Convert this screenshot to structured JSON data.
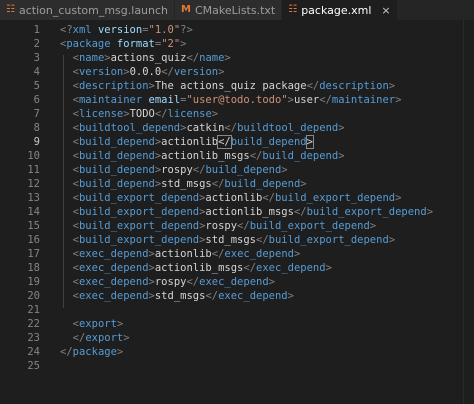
{
  "tabs": [
    {
      "label": "action_custom_msg.launch",
      "icon": "rss-icon",
      "icon_glyph": "☷",
      "icon_color": "#e37933",
      "active": false
    },
    {
      "label": "CMakeLists.txt",
      "icon": "cmake-icon",
      "icon_glyph": "M",
      "icon_color": "#e37933",
      "active": false
    },
    {
      "label": "package.xml",
      "icon": "rss-icon",
      "icon_glyph": "☷",
      "icon_color": "#e37933",
      "active": true,
      "close": "×"
    }
  ],
  "colors": {
    "background": "#1e1e1e",
    "tag": "#569cd6",
    "attribute": "#9cdcfe",
    "string": "#ce9178",
    "punctuation": "#808080",
    "text": "#d4d4d4",
    "line_number": "#858585"
  },
  "current_line": 9,
  "lines": [
    {
      "n": "1",
      "tokens": [
        {
          "t": "punc",
          "v": "<?"
        },
        {
          "t": "tag",
          "v": "xml"
        },
        {
          "t": "text",
          "v": " "
        },
        {
          "t": "attr",
          "v": "version"
        },
        {
          "t": "punc",
          "v": "="
        },
        {
          "t": "str",
          "v": "\"1.0\""
        },
        {
          "t": "punc",
          "v": "?>"
        }
      ]
    },
    {
      "n": "2",
      "tokens": [
        {
          "t": "punc",
          "v": "<"
        },
        {
          "t": "tag",
          "v": "package"
        },
        {
          "t": "text",
          "v": " "
        },
        {
          "t": "attr",
          "v": "format"
        },
        {
          "t": "punc",
          "v": "="
        },
        {
          "t": "str",
          "v": "\"2\""
        },
        {
          "t": "punc",
          "v": ">"
        }
      ]
    },
    {
      "n": "3",
      "tokens": [
        {
          "t": "text",
          "v": "  "
        },
        {
          "t": "punc",
          "v": "<"
        },
        {
          "t": "tag",
          "v": "name"
        },
        {
          "t": "punc",
          "v": ">"
        },
        {
          "t": "text",
          "v": "actions_quiz"
        },
        {
          "t": "punc",
          "v": "</"
        },
        {
          "t": "tag",
          "v": "name"
        },
        {
          "t": "punc",
          "v": ">"
        }
      ]
    },
    {
      "n": "4",
      "tokens": [
        {
          "t": "text",
          "v": "  "
        },
        {
          "t": "punc",
          "v": "<"
        },
        {
          "t": "tag",
          "v": "version"
        },
        {
          "t": "punc",
          "v": ">"
        },
        {
          "t": "text",
          "v": "0.0.0"
        },
        {
          "t": "punc",
          "v": "</"
        },
        {
          "t": "tag",
          "v": "version"
        },
        {
          "t": "punc",
          "v": ">"
        }
      ]
    },
    {
      "n": "5",
      "tokens": [
        {
          "t": "text",
          "v": "  "
        },
        {
          "t": "punc",
          "v": "<"
        },
        {
          "t": "tag",
          "v": "description"
        },
        {
          "t": "punc",
          "v": ">"
        },
        {
          "t": "text",
          "v": "The actions_quiz package"
        },
        {
          "t": "punc",
          "v": "</"
        },
        {
          "t": "tag",
          "v": "description"
        },
        {
          "t": "punc",
          "v": ">"
        }
      ]
    },
    {
      "n": "6",
      "tokens": [
        {
          "t": "text",
          "v": "  "
        },
        {
          "t": "punc",
          "v": "<"
        },
        {
          "t": "tag",
          "v": "maintainer"
        },
        {
          "t": "text",
          "v": " "
        },
        {
          "t": "attr",
          "v": "email"
        },
        {
          "t": "punc",
          "v": "="
        },
        {
          "t": "str",
          "v": "\"user@todo.todo\""
        },
        {
          "t": "punc",
          "v": ">"
        },
        {
          "t": "text",
          "v": "user"
        },
        {
          "t": "punc",
          "v": "</"
        },
        {
          "t": "tag",
          "v": "maintainer"
        },
        {
          "t": "punc",
          "v": ">"
        }
      ]
    },
    {
      "n": "7",
      "tokens": [
        {
          "t": "text",
          "v": "  "
        },
        {
          "t": "punc",
          "v": "<"
        },
        {
          "t": "tag",
          "v": "license"
        },
        {
          "t": "punc",
          "v": ">"
        },
        {
          "t": "text",
          "v": "TODO"
        },
        {
          "t": "punc",
          "v": "</"
        },
        {
          "t": "tag",
          "v": "license"
        },
        {
          "t": "punc",
          "v": ">"
        }
      ]
    },
    {
      "n": "8",
      "tokens": [
        {
          "t": "text",
          "v": "  "
        },
        {
          "t": "punc",
          "v": "<"
        },
        {
          "t": "tag",
          "v": "buildtool_depend"
        },
        {
          "t": "punc",
          "v": ">"
        },
        {
          "t": "text",
          "v": "catkin"
        },
        {
          "t": "punc",
          "v": "</"
        },
        {
          "t": "tag",
          "v": "buildtool_depend"
        },
        {
          "t": "punc",
          "v": ">"
        }
      ]
    },
    {
      "n": "9",
      "tokens": [
        {
          "t": "text",
          "v": "  "
        },
        {
          "t": "punc",
          "v": "<"
        },
        {
          "t": "tag",
          "v": "build_depend"
        },
        {
          "t": "punc",
          "v": ">"
        },
        {
          "t": "text",
          "v": "actionlib"
        },
        {
          "t": "cursor",
          "v": "</"
        },
        {
          "t": "tag",
          "v": "build_depend"
        },
        {
          "t": "cursor",
          "v": ">"
        }
      ]
    },
    {
      "n": "10",
      "tokens": [
        {
          "t": "text",
          "v": "  "
        },
        {
          "t": "punc",
          "v": "<"
        },
        {
          "t": "tag",
          "v": "build_depend"
        },
        {
          "t": "punc",
          "v": ">"
        },
        {
          "t": "text",
          "v": "actionlib_msgs"
        },
        {
          "t": "punc",
          "v": "</"
        },
        {
          "t": "tag",
          "v": "build_depend"
        },
        {
          "t": "punc",
          "v": ">"
        }
      ]
    },
    {
      "n": "11",
      "tokens": [
        {
          "t": "text",
          "v": "  "
        },
        {
          "t": "punc",
          "v": "<"
        },
        {
          "t": "tag",
          "v": "build_depend"
        },
        {
          "t": "punc",
          "v": ">"
        },
        {
          "t": "text",
          "v": "rospy"
        },
        {
          "t": "punc",
          "v": "</"
        },
        {
          "t": "tag",
          "v": "build_depend"
        },
        {
          "t": "punc",
          "v": ">"
        }
      ]
    },
    {
      "n": "12",
      "tokens": [
        {
          "t": "text",
          "v": "  "
        },
        {
          "t": "punc",
          "v": "<"
        },
        {
          "t": "tag",
          "v": "build_depend"
        },
        {
          "t": "punc",
          "v": ">"
        },
        {
          "t": "text",
          "v": "std_msgs"
        },
        {
          "t": "punc",
          "v": "</"
        },
        {
          "t": "tag",
          "v": "build_depend"
        },
        {
          "t": "punc",
          "v": ">"
        }
      ]
    },
    {
      "n": "13",
      "tokens": [
        {
          "t": "text",
          "v": "  "
        },
        {
          "t": "punc",
          "v": "<"
        },
        {
          "t": "tag",
          "v": "build_export_depend"
        },
        {
          "t": "punc",
          "v": ">"
        },
        {
          "t": "text",
          "v": "actionlib"
        },
        {
          "t": "punc",
          "v": "</"
        },
        {
          "t": "tag",
          "v": "build_export_depend"
        },
        {
          "t": "punc",
          "v": ">"
        }
      ]
    },
    {
      "n": "14",
      "tokens": [
        {
          "t": "text",
          "v": "  "
        },
        {
          "t": "punc",
          "v": "<"
        },
        {
          "t": "tag",
          "v": "build_export_depend"
        },
        {
          "t": "punc",
          "v": ">"
        },
        {
          "t": "text",
          "v": "actionlib_msgs"
        },
        {
          "t": "punc",
          "v": "</"
        },
        {
          "t": "tag",
          "v": "build_export_depend"
        },
        {
          "t": "punc",
          "v": ">"
        }
      ]
    },
    {
      "n": "15",
      "tokens": [
        {
          "t": "text",
          "v": "  "
        },
        {
          "t": "punc",
          "v": "<"
        },
        {
          "t": "tag",
          "v": "build_export_depend"
        },
        {
          "t": "punc",
          "v": ">"
        },
        {
          "t": "text",
          "v": "rospy"
        },
        {
          "t": "punc",
          "v": "</"
        },
        {
          "t": "tag",
          "v": "build_export_depend"
        },
        {
          "t": "punc",
          "v": ">"
        }
      ]
    },
    {
      "n": "16",
      "tokens": [
        {
          "t": "text",
          "v": "  "
        },
        {
          "t": "punc",
          "v": "<"
        },
        {
          "t": "tag",
          "v": "build_export_depend"
        },
        {
          "t": "punc",
          "v": ">"
        },
        {
          "t": "text",
          "v": "std_msgs"
        },
        {
          "t": "punc",
          "v": "</"
        },
        {
          "t": "tag",
          "v": "build_export_depend"
        },
        {
          "t": "punc",
          "v": ">"
        }
      ]
    },
    {
      "n": "17",
      "tokens": [
        {
          "t": "text",
          "v": "  "
        },
        {
          "t": "punc",
          "v": "<"
        },
        {
          "t": "tag",
          "v": "exec_depend"
        },
        {
          "t": "punc",
          "v": ">"
        },
        {
          "t": "text",
          "v": "actionlib"
        },
        {
          "t": "punc",
          "v": "</"
        },
        {
          "t": "tag",
          "v": "exec_depend"
        },
        {
          "t": "punc",
          "v": ">"
        }
      ]
    },
    {
      "n": "18",
      "tokens": [
        {
          "t": "text",
          "v": "  "
        },
        {
          "t": "punc",
          "v": "<"
        },
        {
          "t": "tag",
          "v": "exec_depend"
        },
        {
          "t": "punc",
          "v": ">"
        },
        {
          "t": "text",
          "v": "actionlib_msgs"
        },
        {
          "t": "punc",
          "v": "</"
        },
        {
          "t": "tag",
          "v": "exec_depend"
        },
        {
          "t": "punc",
          "v": ">"
        }
      ]
    },
    {
      "n": "19",
      "tokens": [
        {
          "t": "text",
          "v": "  "
        },
        {
          "t": "punc",
          "v": "<"
        },
        {
          "t": "tag",
          "v": "exec_depend"
        },
        {
          "t": "punc",
          "v": ">"
        },
        {
          "t": "text",
          "v": "rospy"
        },
        {
          "t": "punc",
          "v": "</"
        },
        {
          "t": "tag",
          "v": "exec_depend"
        },
        {
          "t": "punc",
          "v": ">"
        }
      ]
    },
    {
      "n": "20",
      "tokens": [
        {
          "t": "text",
          "v": "  "
        },
        {
          "t": "punc",
          "v": "<"
        },
        {
          "t": "tag",
          "v": "exec_depend"
        },
        {
          "t": "punc",
          "v": ">"
        },
        {
          "t": "text",
          "v": "std_msgs"
        },
        {
          "t": "punc",
          "v": "</"
        },
        {
          "t": "tag",
          "v": "exec_depend"
        },
        {
          "t": "punc",
          "v": ">"
        }
      ]
    },
    {
      "n": "21",
      "tokens": []
    },
    {
      "n": "22",
      "tokens": [
        {
          "t": "text",
          "v": "  "
        },
        {
          "t": "punc",
          "v": "<"
        },
        {
          "t": "tag",
          "v": "export"
        },
        {
          "t": "punc",
          "v": ">"
        }
      ]
    },
    {
      "n": "23",
      "tokens": [
        {
          "t": "text",
          "v": "  "
        },
        {
          "t": "punc",
          "v": "</"
        },
        {
          "t": "tag",
          "v": "export"
        },
        {
          "t": "punc",
          "v": ">"
        }
      ]
    },
    {
      "n": "24",
      "tokens": [
        {
          "t": "punc",
          "v": "</"
        },
        {
          "t": "tag",
          "v": "package"
        },
        {
          "t": "punc",
          "v": ">"
        }
      ]
    },
    {
      "n": "25",
      "tokens": []
    }
  ]
}
